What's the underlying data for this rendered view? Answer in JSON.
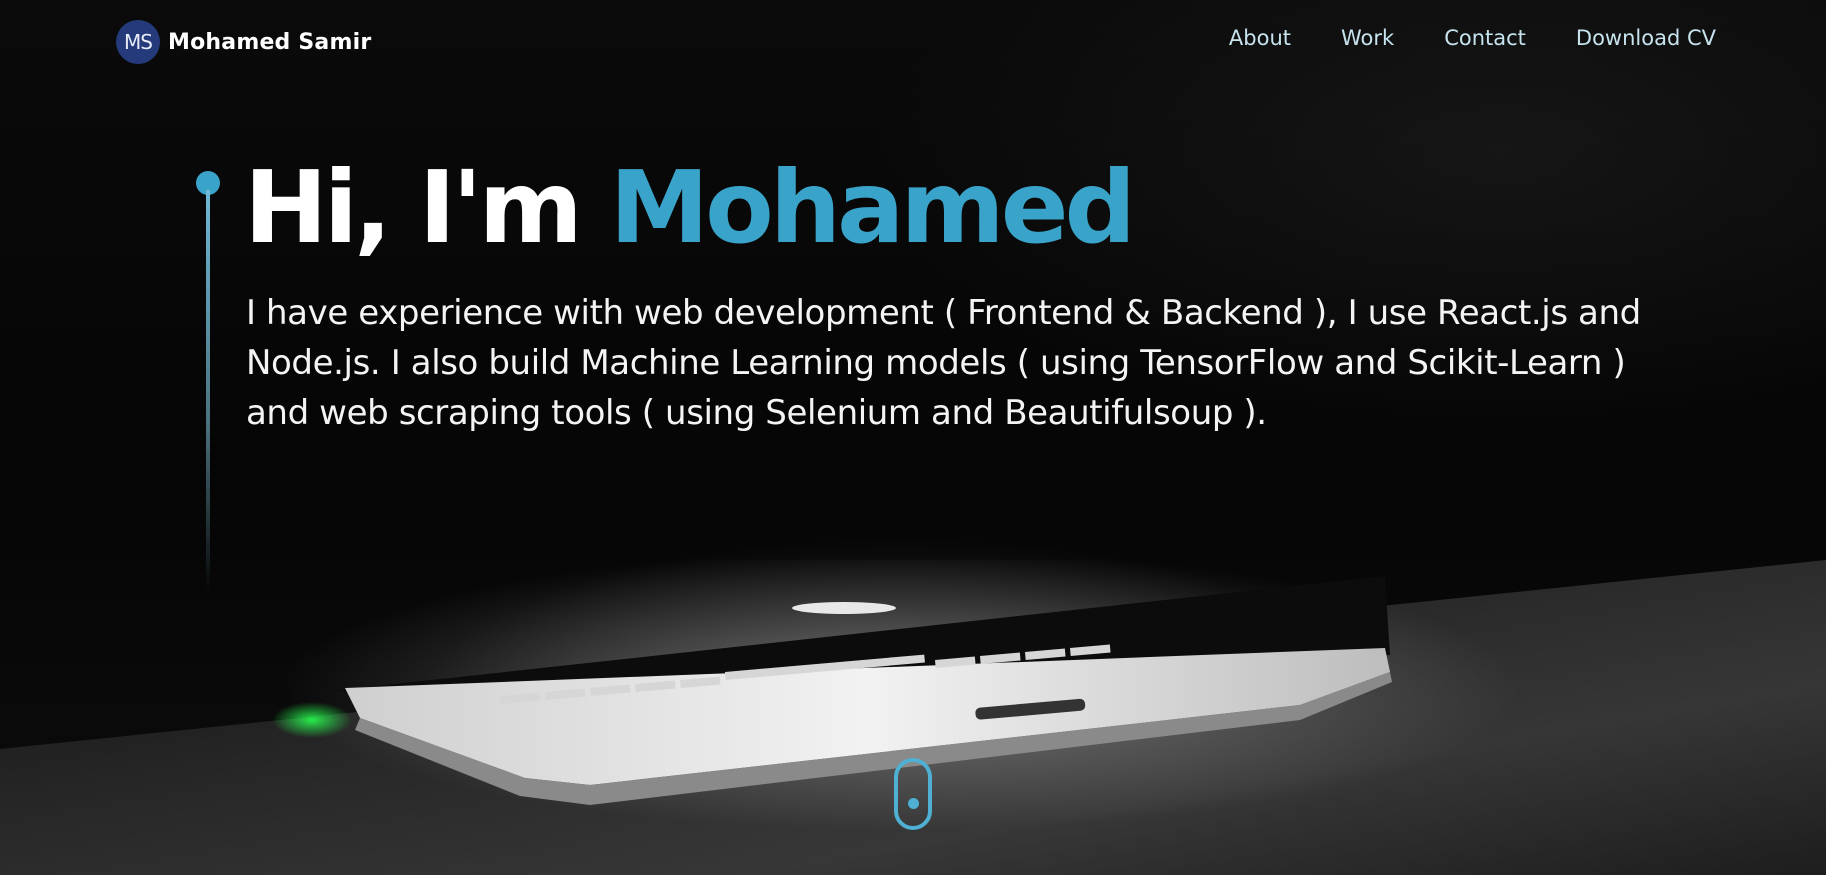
{
  "nav": {
    "logo_initials": "MS",
    "logo_name": "Mohamed Samir",
    "links": [
      {
        "label": "About"
      },
      {
        "label": "Work"
      },
      {
        "label": "Contact"
      },
      {
        "label": "Download CV"
      }
    ]
  },
  "hero": {
    "greeting": "Hi, I'm",
    "name": "Mohamed",
    "intro": "I have experience with web development ( Frontend & Backend ), I use React.js and Node.js. I also build Machine Learning models ( using TensorFlow and Scikit-Learn ) and web scraping tools ( using Selenium and Beautifulsoup )."
  },
  "icons": {
    "scroll": "mouse-scroll-icon",
    "accent": "timeline-dot-icon"
  },
  "colors": {
    "accent": "#3aa3c9",
    "nav_link": "#c6e3ee",
    "logo_badge": "#243a7a",
    "background": "#050505"
  }
}
